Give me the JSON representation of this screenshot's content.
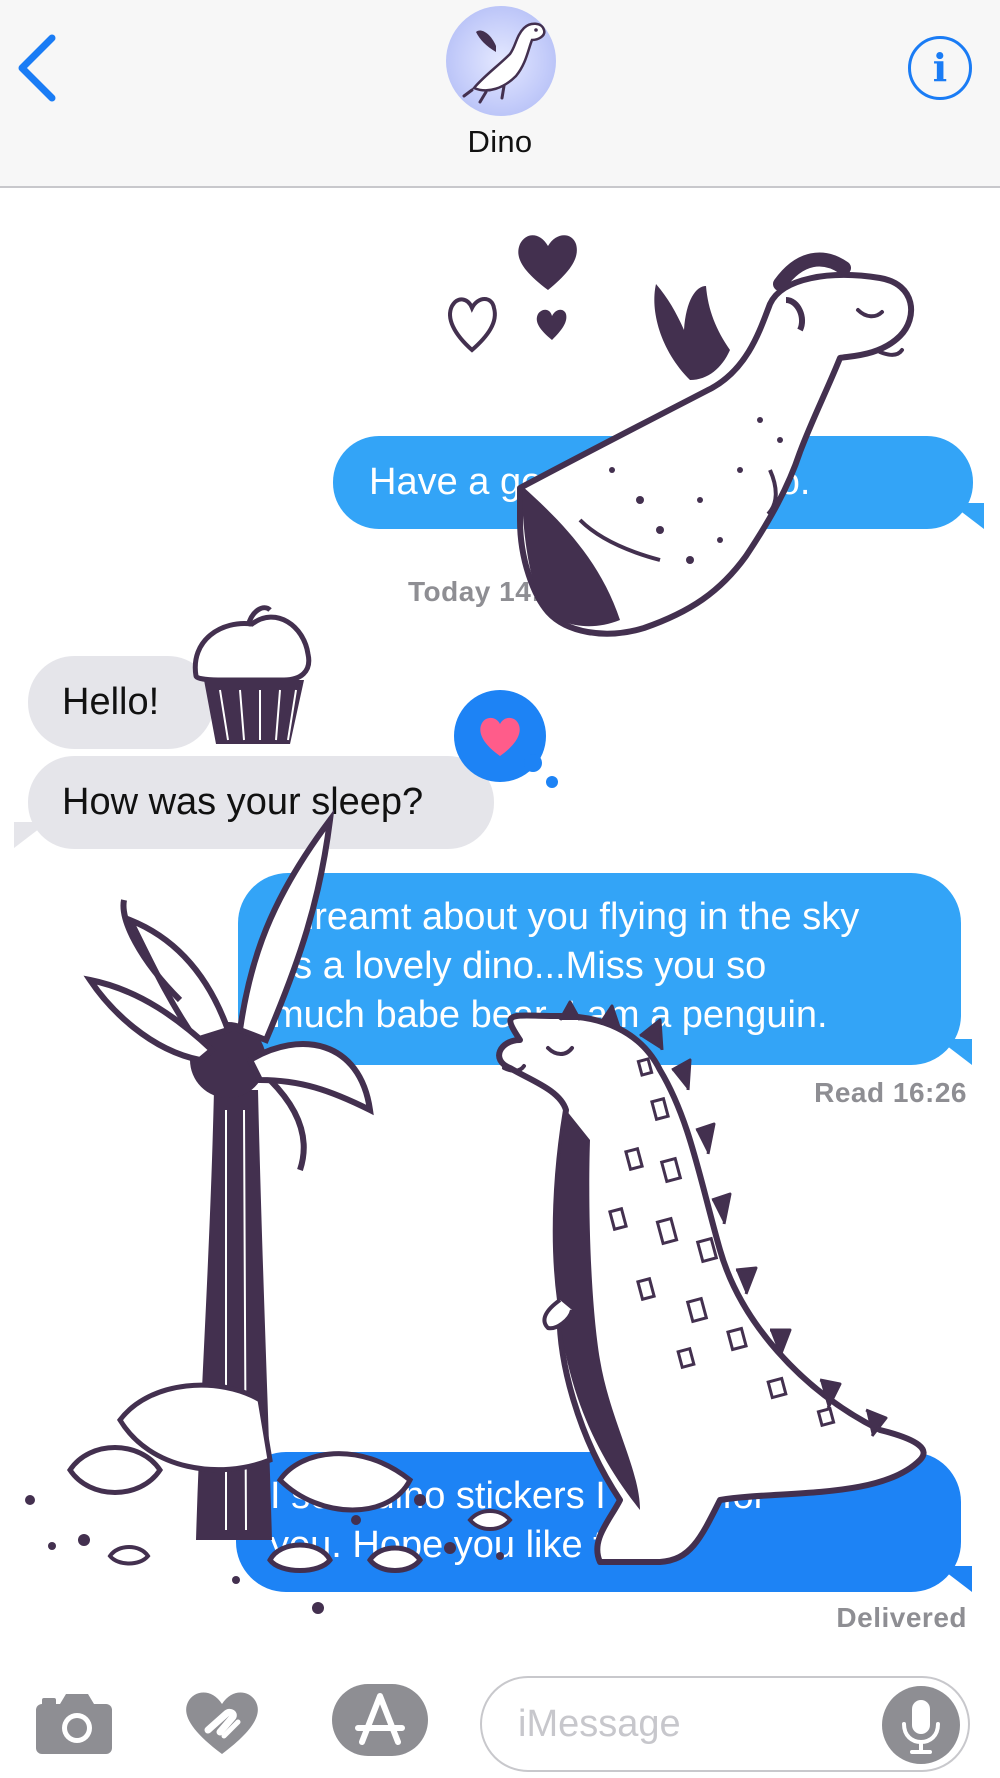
{
  "header": {
    "contact_name": "Dino",
    "back_icon": "chevron-left-icon",
    "info_icon": "info-icon",
    "info_glyph": "i"
  },
  "messages": [
    {
      "side": "sent",
      "text": "Have a good day my dino."
    },
    {
      "timestamp": "Today 14:25"
    },
    {
      "side": "received",
      "text": "Hello!"
    },
    {
      "side": "received",
      "text": "How was your sleep?",
      "reaction": "heart"
    },
    {
      "side": "sent",
      "text_lines": [
        "I dreamt about you flying in the sky",
        "as a lovely dino...Miss you so",
        "much babe bear, I am a penguin."
      ]
    },
    {
      "status": "Read 16:26"
    },
    {
      "side": "sent",
      "text_lines": [
        "I sent dino stickers I made for",
        "you. Hope you like them."
      ]
    },
    {
      "status": "Delivered"
    }
  ],
  "composer": {
    "placeholder": "iMessage",
    "camera_icon": "camera-icon",
    "digital_touch_icon": "digital-touch-icon",
    "app_store_icon": "app-store-icon",
    "mic_icon": "microphone-icon"
  },
  "colors": {
    "sent_bubble": "#33a4f7",
    "sent_bubble_last": "#1d83f5",
    "received_bubble": "#e5e5ea",
    "accent": "#1a7cf5",
    "heart": "#ff5c8a",
    "sticker_ink": "#43304f"
  }
}
